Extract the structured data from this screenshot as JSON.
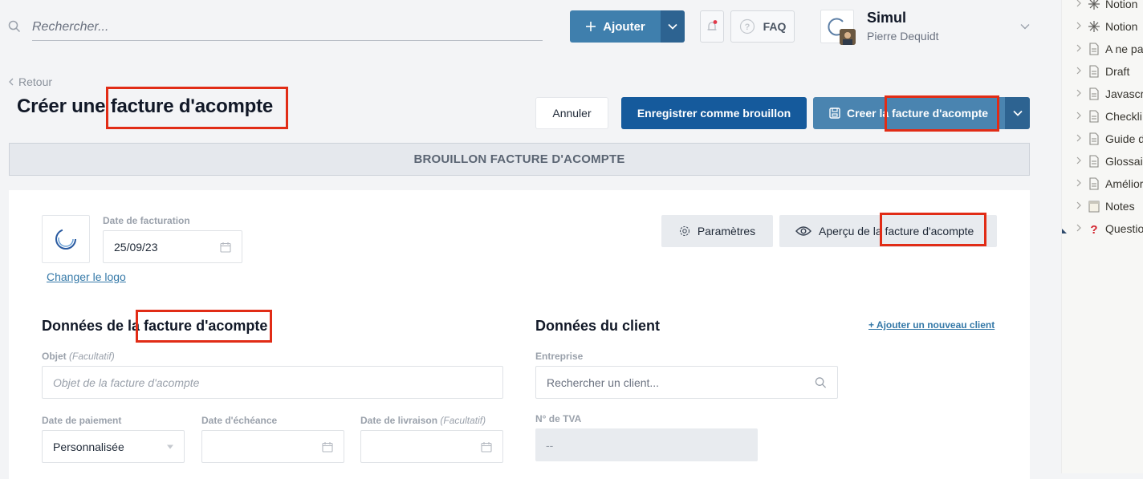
{
  "topbar": {
    "search_placeholder": "Rechercher...",
    "add_label": "Ajouter",
    "faq_label": "FAQ",
    "account_name": "Simul",
    "account_user": "Pierre Dequidt"
  },
  "header": {
    "back_label": "Retour",
    "title_prefix": "Créer une ",
    "title_highlight": "facture d'acompte",
    "cancel_label": "Annuler",
    "save_draft_label": "Enregistrer comme brouillon",
    "create_prefix": "Creer la ",
    "create_highlight": "facture d'acompte"
  },
  "status_banner": "BROUILLON FACTURE D'ACOMPTE",
  "invoice_top": {
    "date_label": "Date de facturation",
    "date_value": "25/09/23",
    "change_logo_label": "Changer le logo",
    "params_label": "Paramètres",
    "preview_prefix": "Aperçu de la ",
    "preview_highlight": "facture d'acompte"
  },
  "invoice_data": {
    "title_prefix": "Données de la ",
    "title_highlight": "facture d'acompte",
    "object_label": "Objet",
    "object_optional": "(Facultatif)",
    "object_placeholder": "Objet de la facture d'acompte",
    "payment_date_label": "Date de paiement",
    "payment_date_value": "Personnalisée",
    "due_date_label": "Date d'échéance",
    "delivery_date_label": "Date de livraison",
    "delivery_optional": "(Facultatif)"
  },
  "client_data": {
    "title": "Données du client",
    "add_client_label": "+ Ajouter un nouveau client",
    "company_label": "Entreprise",
    "company_placeholder": "Rechercher un client...",
    "vat_label": "N° de TVA",
    "vat_value": "--"
  },
  "sidebar": {
    "items": [
      {
        "label": "Notion",
        "icon": "notion-burst-icon"
      },
      {
        "label": "Notion",
        "icon": "notion-burst-icon"
      },
      {
        "label": "A ne pa",
        "icon": "page-icon"
      },
      {
        "label": "Draft",
        "icon": "page-icon"
      },
      {
        "label": "Javascr",
        "icon": "page-icon"
      },
      {
        "label": "Checkli",
        "icon": "page-icon"
      },
      {
        "label": "Guide d",
        "icon": "page-icon"
      },
      {
        "label": "Glossai",
        "icon": "page-icon"
      },
      {
        "label": "Amélior",
        "icon": "page-icon"
      },
      {
        "label": "Notes",
        "icon": "notepad-icon"
      },
      {
        "label": "Questio",
        "icon": "question-mark-icon"
      }
    ]
  },
  "colors": {
    "primary": "#155a9c",
    "secondary_blue": "#4a84b0",
    "highlight": "#e12c16"
  }
}
